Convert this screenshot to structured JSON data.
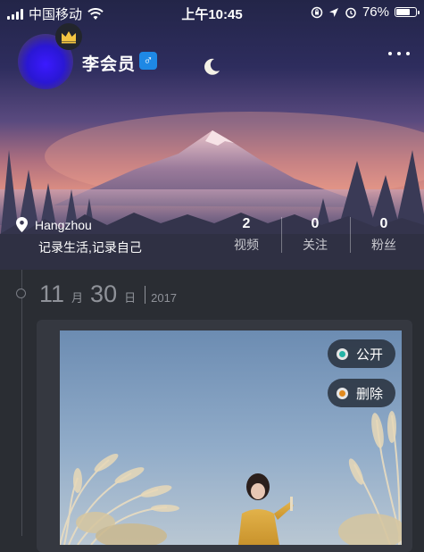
{
  "status_bar": {
    "carrier": "中国移动",
    "time": "上午10:45",
    "battery": "76%",
    "battery_level": 0.76,
    "icons": [
      "signal-icon",
      "wifi-icon",
      "lock-rotation-icon",
      "location-arrow-icon",
      "alarm-icon",
      "battery-icon"
    ]
  },
  "profile": {
    "username": "李会员",
    "gender_symbol": "♂",
    "location": "Hangzhou",
    "bio": "记录生活,记录自己"
  },
  "stats": [
    {
      "value": "2",
      "label": "视频"
    },
    {
      "value": "0",
      "label": "关注"
    },
    {
      "value": "0",
      "label": "粉丝"
    }
  ],
  "post": {
    "day": "11",
    "day_unit": "日",
    "month": "30",
    "month_unit": "月",
    "year": "2017",
    "actions": [
      {
        "label": "公开",
        "color": "#26b3a6"
      },
      {
        "label": "删除",
        "color": "#e08a1e"
      }
    ]
  },
  "colors": {
    "gender_badge": "#1e88e5",
    "page_bg": "#2a2d33",
    "card_bg": "#353840"
  }
}
